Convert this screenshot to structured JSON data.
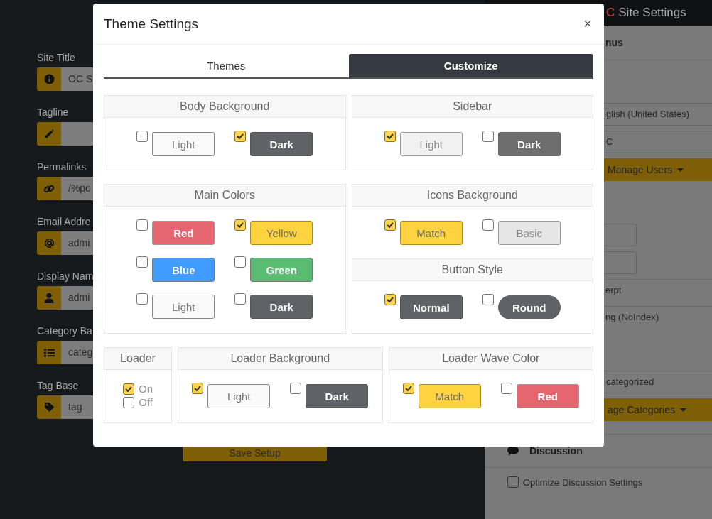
{
  "page": {
    "fields": [
      {
        "label": "Site Title",
        "value": "OC S"
      },
      {
        "label": "Tagline"
      },
      {
        "label": "Permalinks",
        "value": "/%po"
      },
      {
        "label": "Email Addre",
        "value": "admi"
      },
      {
        "label": "Display Nam",
        "value": "admi"
      },
      {
        "label": "Category Ba",
        "value": "categ"
      },
      {
        "label": "Tag Base",
        "value": "tag"
      }
    ],
    "save_button": "Save Setup",
    "side_panel": {
      "title_mark": "C",
      "title": "Site Settings",
      "items": [
        {
          "kind": "heading",
          "text": "nus"
        },
        {
          "kind": "select",
          "text": "glish (United States)"
        },
        {
          "kind": "select",
          "text": "C"
        },
        {
          "kind": "dropdown",
          "text": "Manage Users"
        },
        {
          "kind": "input"
        },
        {
          "kind": "input"
        },
        {
          "kind": "row",
          "text": "erpt"
        },
        {
          "kind": "row",
          "text": "ng (NoIndex)"
        },
        {
          "kind": "select",
          "text": "categorized"
        },
        {
          "kind": "dropdown",
          "text": "age Categories"
        },
        {
          "kind": "section",
          "text": "Discussion"
        },
        {
          "kind": "checkbox",
          "text": "Optimize Discussion Settings",
          "checked": false
        }
      ]
    }
  },
  "modal": {
    "title": "Theme Settings",
    "close": "×",
    "tabs": [
      {
        "label": "Themes",
        "selected": false
      },
      {
        "label": "Customize",
        "selected": true
      }
    ],
    "rows": [
      [
        [
          {
            "kind": "swatches",
            "title": "Body Background",
            "options": [
              {
                "label": "Light",
                "kind": "light",
                "checked": false
              },
              {
                "label": "Dark",
                "kind": "dark",
                "checked": true
              }
            ]
          }
        ],
        [
          {
            "kind": "swatches",
            "title": "Sidebar",
            "options": [
              {
                "label": "Light",
                "kind": "pale",
                "checked": true
              },
              {
                "label": "Dark",
                "kind": "grey",
                "checked": false
              }
            ]
          }
        ]
      ],
      [
        [
          {
            "kind": "swatches",
            "title": "Main Colors",
            "options": [
              {
                "label": "Red",
                "kind": "red",
                "checked": false
              },
              {
                "label": "Yellow",
                "kind": "yellow",
                "checked": true
              },
              {
                "label": "Blue",
                "kind": "blue",
                "checked": false
              },
              {
                "label": "Green",
                "kind": "green",
                "checked": false
              },
              {
                "label": "Light",
                "kind": "light",
                "checked": false
              },
              {
                "label": "Dark",
                "kind": "dark",
                "checked": false
              }
            ]
          }
        ],
        [
          {
            "kind": "swatches",
            "title": "Icons Background",
            "options": [
              {
                "label": "Match",
                "kind": "yellow",
                "checked": true
              },
              {
                "label": "Basic",
                "kind": "basic",
                "checked": false
              }
            ]
          },
          {
            "kind": "swatches",
            "title": "Button Style",
            "options": [
              {
                "label": "Normal",
                "kind": "dark",
                "checked": true
              },
              {
                "label": "Round",
                "kind": "round",
                "checked": false
              }
            ]
          }
        ]
      ],
      [
        [
          {
            "kind": "toggle",
            "title": "Loader",
            "options": [
              {
                "label": "On",
                "checked": true
              },
              {
                "label": "Off",
                "checked": false
              }
            ]
          }
        ],
        [
          {
            "kind": "swatches",
            "title": "Loader Background",
            "options": [
              {
                "label": "Light",
                "kind": "light",
                "checked": true
              },
              {
                "label": "Dark",
                "kind": "dark",
                "checked": false
              }
            ]
          }
        ],
        [
          {
            "kind": "swatches",
            "title": "Loader Wave Color",
            "options": [
              {
                "label": "Match",
                "kind": "yellow",
                "checked": true
              },
              {
                "label": "Red",
                "kind": "red",
                "checked": false
              }
            ]
          }
        ]
      ]
    ]
  }
}
